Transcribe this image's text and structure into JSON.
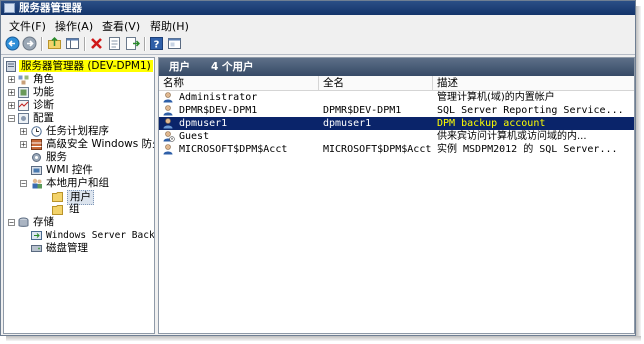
{
  "window": {
    "title": "服务器管理器"
  },
  "menu": [
    {
      "label": "文件(F)"
    },
    {
      "label": "操作(A)"
    },
    {
      "label": "查看(V)"
    },
    {
      "label": "帮助(H)"
    }
  ],
  "toolbar": [
    "back-icon",
    "forward-icon",
    "up-folder-icon",
    "show-hide-tree-icon",
    "delete-icon",
    "properties-icon",
    "export-list-icon",
    "help-icon",
    "console-view-icon"
  ],
  "tree": {
    "root": "服务器管理器 (DEV-DPM1)",
    "nodes": [
      {
        "label": "角色"
      },
      {
        "label": "功能"
      },
      {
        "label": "诊断"
      },
      {
        "label": "配置"
      },
      {
        "label": "任务计划程序"
      },
      {
        "label": "高级安全 Windows 防火墙"
      },
      {
        "label": "服务"
      },
      {
        "label": "WMI 控件"
      },
      {
        "label": "本地用户和组"
      },
      {
        "label": "用户"
      },
      {
        "label": "组"
      },
      {
        "label": "存储"
      },
      {
        "label": "Windows Server Backup"
      },
      {
        "label": "磁盘管理"
      }
    ]
  },
  "panel": {
    "title": "用户",
    "count": "4 个用户"
  },
  "columns": [
    "名称",
    "全名",
    "描述"
  ],
  "rows": [
    {
      "name": "Administrator",
      "fullname": "",
      "description": "管理计算机(域)的内置帐户"
    },
    {
      "name": "DPMR$DEV-DPM1",
      "fullname": "DPMR$DEV-DPM1",
      "description": "SQL Server Reporting Service..."
    },
    {
      "name": "dpmuser1",
      "fullname": "dpmuser1",
      "description": "DPM backup account"
    },
    {
      "name": "Guest",
      "fullname": "",
      "description": "供来宾访问计算机或访问域的内..."
    },
    {
      "name": "MICROSOFT$DPM$Acct",
      "fullname": "MICROSOFT$DPM$Acct",
      "description": "实例 MSDPM2012 的 SQL Server..."
    }
  ],
  "colors": {
    "accent": "#0a246a",
    "highlight": "#ffff00",
    "titlebar": "#13346a"
  }
}
